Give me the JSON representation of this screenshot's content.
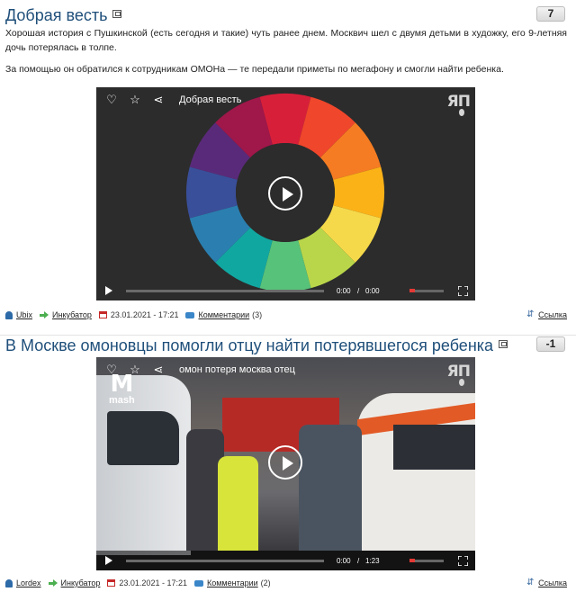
{
  "colors": {
    "title": "#1f4f7a",
    "accent_red": "#e53935",
    "video_bg": "#2c2c2c"
  },
  "post1": {
    "title": "Добрая весть",
    "rating": "7",
    "text_line1": "Хорошая история с Пушкинской (есть сегодня и такие) чуть ранее днем. Москвич шел с двумя детьми в художку, его 9-летняя дочь потерялась в толпе.",
    "text_line2": "За помощью он обратился к сотрудникам ОМОНа — те передали приметы по мегафону и смогли найти ребенка.",
    "video": {
      "title": "Добрая весть",
      "time_current": "0:00",
      "time_sep": "/",
      "time_total": "0:00",
      "logo": "ЯП"
    },
    "meta": {
      "author": "Ubix",
      "category": "Инкубатор",
      "date": "23.01.2021 - 17:21",
      "comments_label": "Комментарии",
      "comments_count": "(3)",
      "link_label": "Ссылка"
    }
  },
  "post2": {
    "title": "В Москве омоновцы помогли отцу найти потерявшегося ребенка",
    "rating": "-1",
    "video": {
      "title": "омон потеря москва отец",
      "time_current": "0:00",
      "time_sep": "/",
      "time_total": "1:23",
      "logo": "ЯП",
      "watermark": "mash"
    },
    "meta": {
      "author": "Lordex",
      "category": "Инкубатор",
      "date": "23.01.2021 - 17:21",
      "comments_label": "Комментарии",
      "comments_count": "(2)",
      "link_label": "Ссылка"
    }
  },
  "wheel_colors": [
    "#d81f3a",
    "#f0462b",
    "#f57c22",
    "#fbb217",
    "#f6d94a",
    "#b9d64a",
    "#57c27a",
    "#11a7a1",
    "#2a7fb0",
    "#3a4f9a",
    "#5a2a7a",
    "#a0174a"
  ]
}
